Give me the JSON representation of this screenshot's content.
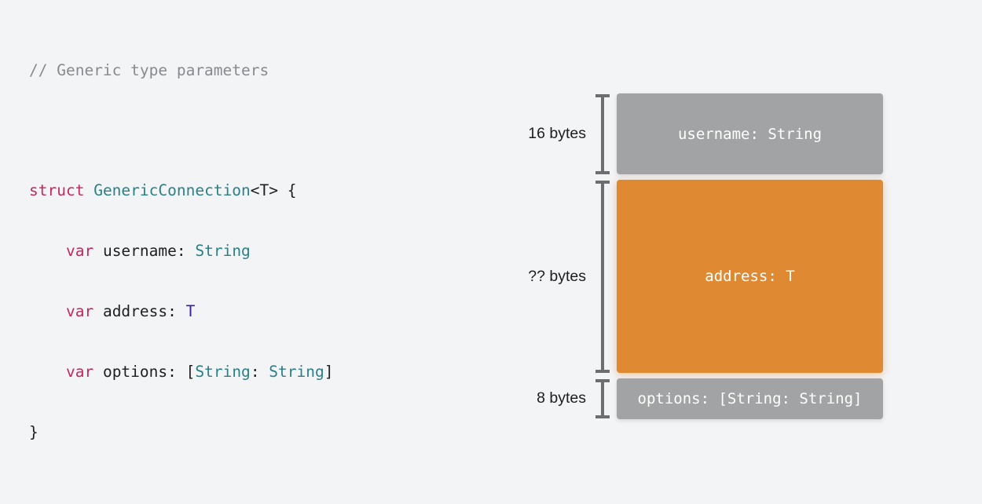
{
  "code": {
    "comment": "// Generic type parameters",
    "line1": {
      "kw": "struct",
      "name": "GenericConnection",
      "generic": "<T> {"
    },
    "line2": {
      "kw": "var",
      "field": "username: ",
      "type": "String"
    },
    "line3": {
      "kw": "var",
      "field": "address: ",
      "type": "T"
    },
    "line4": {
      "kw": "var",
      "field": "options: [",
      "type1": "String",
      "sep": ": ",
      "type2": "String",
      "close": "]"
    },
    "close": "}"
  },
  "layout_diagram": {
    "fields": [
      {
        "size_label": "16 bytes",
        "block_label": "username: String",
        "color": "#a2a3a4"
      },
      {
        "size_label": "?? bytes",
        "block_label": "address: T",
        "color": "#df8a33"
      },
      {
        "size_label": "8 bytes",
        "block_label": "options: [String: String]",
        "color": "#a2a3a4"
      }
    ]
  },
  "colors": {
    "keyword": "#c2285c",
    "type": "#2b7f86",
    "generic_param": "#3a1f9c",
    "comment": "#8a8a8e"
  }
}
